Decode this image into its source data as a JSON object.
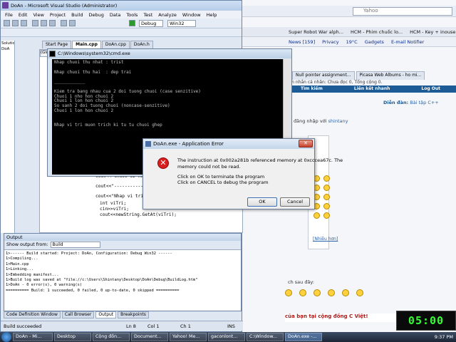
{
  "browser": {
    "search_placeholder": "Yahoo",
    "toolbar_items": [
      "Super Robot War alph...",
      "HCM - Phim chuốc lo...",
      "HCM - Key + inouse k..."
    ],
    "bookmarks": [
      "News [159]",
      "Privacy",
      "19°C",
      "Gadgets",
      "E-mail Notifier"
    ],
    "tabs": [
      "Null pointer assignment...",
      "Picasa Web Albums - ho mi..."
    ],
    "forum_note": "Tin nhắn cá nhân: Chưa đọc 0, Tổng cộng 0.",
    "forum_nav": [
      "Tìm kiếm",
      "Liên kết nhanh",
      "Log Out"
    ],
    "crumb_label": "Diễn đàn:",
    "crumb_link": "Bài tập C++",
    "login_text": "đăng nhập với",
    "login_user": "shintany",
    "more_label": "[Nhiều hơn]",
    "reply_hint": "ch sau đây:",
    "banner": "của bạn tại cộng đồng C Việt!",
    "clock": "05:00"
  },
  "vs": {
    "title": "DoAn - Microsoft Visual Studio (Administrator)",
    "menu": [
      "File",
      "Edit",
      "View",
      "Project",
      "Build",
      "Debug",
      "Data",
      "Tools",
      "Test",
      "Analyze",
      "Window",
      "Help"
    ],
    "config": "Debug",
    "platform": "Win32",
    "doc_tabs": [
      "Start Page",
      "Main.cpp",
      "DoAn.cpp",
      "DoAn.h"
    ],
    "scope": "(Global",
    "solution_items": [
      "Solution",
      "DoA"
    ],
    "code_lines": [
      "cout<<\"Chuoi s2 Xuat hien trong...",
      "cout<<\"-----------\"<<endl;",
      "cout<<\"Nhap vi tri muon trich ki...",
      "int viTri;",
      "cin>>viTri;",
      "cout<<newString.GetAt(viTri);"
    ],
    "output_title": "Output",
    "output_from_label": "Show output from:",
    "output_from_value": "Build",
    "output_lines": [
      "1>------ Build started: Project: DoAn, Configuration: Debug Win32 ------",
      "1>Compiling...",
      "1>Main.cpp",
      "1>Linking...",
      "1>Embedding manifest...",
      "1>Build log was saved at \"file://c:\\Users\\Shintany\\Desktop\\DoAn\\Debug\\BuildLog.htm\"",
      "1>DoAn - 0 error(s), 0 warning(s)",
      "========== Build: 1 succeeded, 0 failed, 0 up-to-date, 0 skipped =========="
    ],
    "bottom_tabs": [
      "Code Definition Window",
      "Call Browser",
      "Output",
      "Breakpoints"
    ],
    "status": {
      "left": "Build succeeded",
      "ln": "Ln 8",
      "col": "Col 1",
      "ch": "Ch 1",
      "ins": "INS"
    }
  },
  "console": {
    "title": "C:\\Windows\\system32\\cmd.exe",
    "lines": [
      "Nhap chuoi thu nhat : trist",
      "",
      "Nhap chuoi thu hai  : dep trai",
      "",
      "____________",
      "",
      "Kiem tra bang nhau cua 2 doi tuong chuoi (case senzitive)",
      "Chuoi 1 nho hon chuoi 2",
      "Chuoi 1 lon hon chuoi 2",
      "So sanh 2 doi tuong chuoi (noncase-senzitive)",
      "Chuoi 1 lon hon chuoi 2",
      "",
      "",
      "Nhap vi tri muon trich ki tu tu chuoi ghep"
    ]
  },
  "dialog": {
    "title": "DoAn.exe - Application Error",
    "msg1": "The instruction at 0x002a281b referenced memory at 0xcccea67c. The",
    "msg2": "memory could not be read.",
    "msg3": "Click on OK to terminate the program",
    "msg4": "Click on CANCEL to debug the program",
    "ok": "OK",
    "cancel": "Cancel"
  },
  "taskbar": {
    "items": [
      "DoAn - Mi...",
      "Desktop",
      "Cộng đồn...",
      "Document...",
      "Yahoo! Me...",
      "gaconlont...",
      "C:\\Window...",
      "DoAn.exe -..."
    ],
    "time": "9:37 PM"
  }
}
